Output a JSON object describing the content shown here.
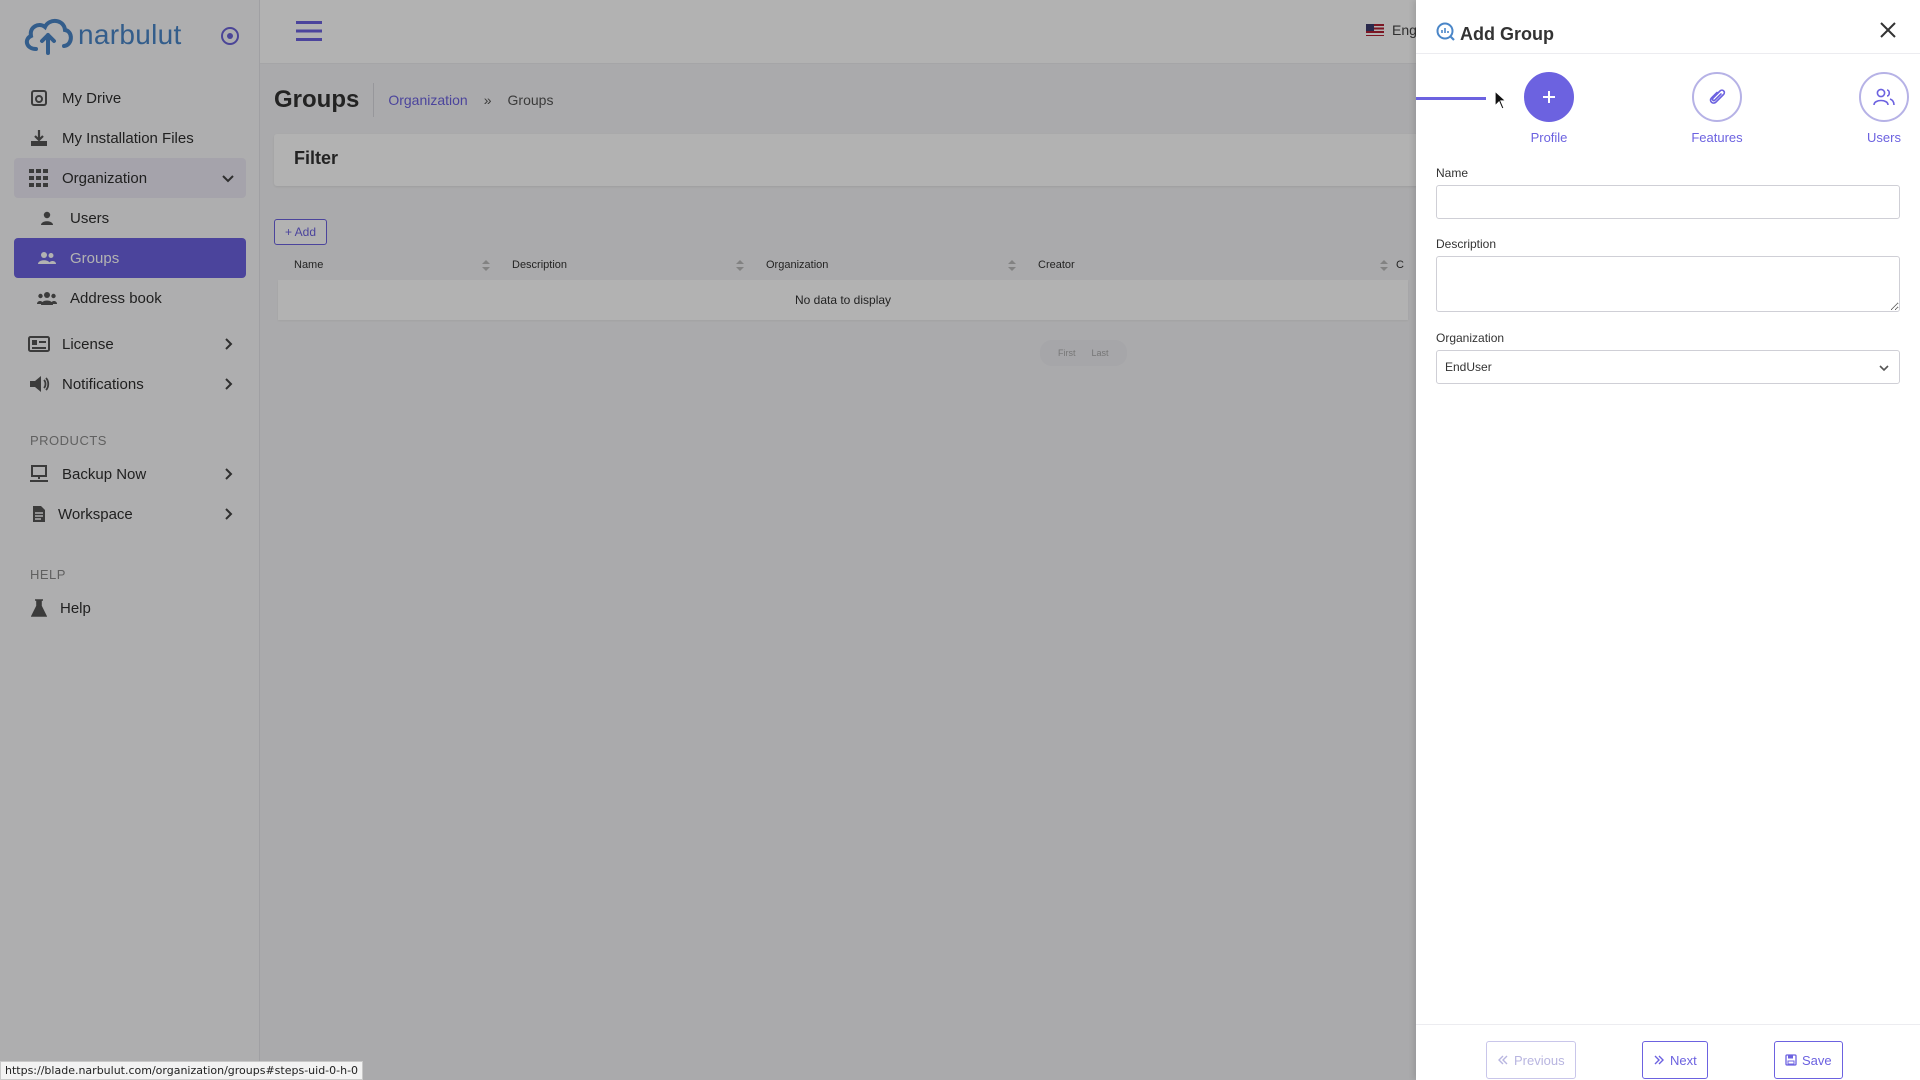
{
  "brand": {
    "name": "narbulut"
  },
  "sidebar": {
    "items": [
      {
        "label": "My Drive",
        "icon": "drive-icon"
      },
      {
        "label": "My Installation Files",
        "icon": "download-icon"
      },
      {
        "label": "Organization",
        "icon": "grid-icon"
      },
      {
        "label": "Users",
        "icon": "user-icon"
      },
      {
        "label": "Groups",
        "icon": "users-icon"
      },
      {
        "label": "Address book",
        "icon": "address-book-icon"
      },
      {
        "label": "License",
        "icon": "id-card-icon"
      },
      {
        "label": "Notifications",
        "icon": "megaphone-icon"
      }
    ],
    "products_heading": "PRODUCTS",
    "products": [
      {
        "label": "Backup Now",
        "icon": "server-icon"
      },
      {
        "label": "Workspace",
        "icon": "document-icon"
      }
    ],
    "help_heading": "HELP",
    "help": [
      {
        "label": "Help",
        "icon": "flask-icon"
      }
    ]
  },
  "header": {
    "language": "Eng"
  },
  "page": {
    "title": "Groups",
    "breadcrumb": {
      "parent": "Organization",
      "separator": "»",
      "current": "Groups"
    },
    "filter_title": "Filter",
    "add_button": "+ Add",
    "table": {
      "columns": [
        "Name",
        "Description",
        "Organization",
        "Creator",
        "C"
      ],
      "empty_text": "No data to display"
    },
    "pager": {
      "first": "First",
      "last": "Last"
    }
  },
  "drawer": {
    "title": "Add Group",
    "steps": [
      {
        "label": "Profile",
        "icon": "plus-icon",
        "active": true
      },
      {
        "label": "Features",
        "icon": "paperclip-icon",
        "active": false
      },
      {
        "label": "Users",
        "icon": "users-icon",
        "active": false
      }
    ],
    "form": {
      "name_label": "Name",
      "name_value": "",
      "description_label": "Description",
      "description_value": "",
      "organization_label": "Organization",
      "organization_value": "EndUser"
    },
    "footer": {
      "previous": "Previous",
      "next": "Next",
      "save": "Save"
    }
  },
  "statusbar": {
    "url": "https://blade.narbulut.com/organization/groups#steps-uid-0-h-0"
  },
  "colors": {
    "accent": "#6c62e0",
    "brand": "#4a86c8"
  }
}
